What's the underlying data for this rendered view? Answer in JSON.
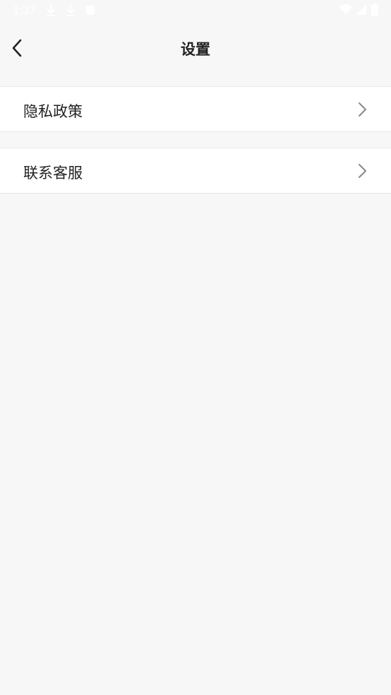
{
  "status_bar": {
    "time": "1:37",
    "icons": [
      "download-icon",
      "download-icon",
      "notification-icon",
      "wifi-icon",
      "signal-icon",
      "battery-icon"
    ]
  },
  "header": {
    "title": "设置",
    "back_icon": "chevron-left-icon"
  },
  "settings": {
    "items": [
      {
        "label": "隐私政策",
        "icon": "chevron-right-icon"
      },
      {
        "label": "联系客服",
        "icon": "chevron-right-icon"
      }
    ]
  },
  "colors": {
    "background": "#f7f7f7",
    "row_background": "#ffffff",
    "text": "#222222",
    "chevron": "#888888"
  }
}
